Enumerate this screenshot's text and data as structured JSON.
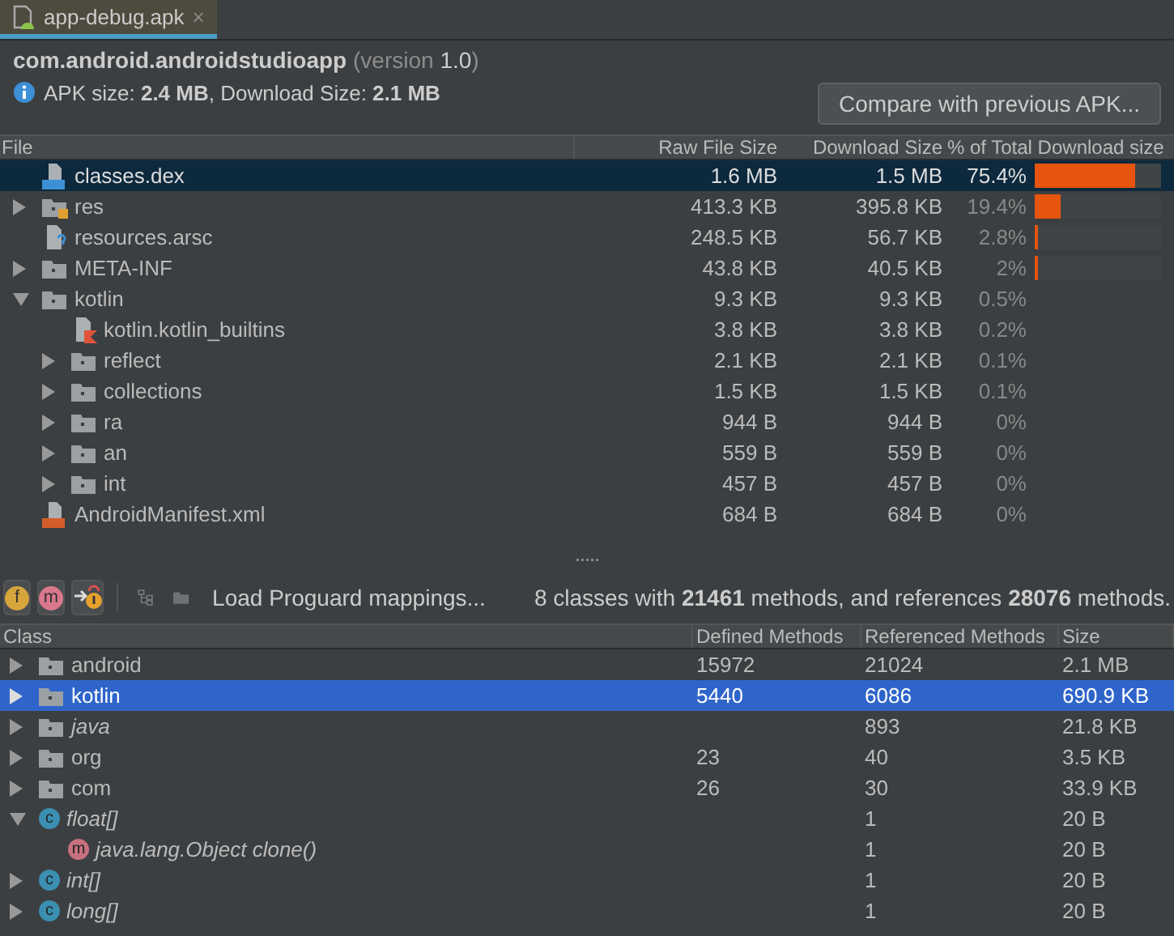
{
  "tab": {
    "label": "app-debug.apk",
    "close": "×",
    "selected": true
  },
  "header": {
    "package": "com.android.androidstudioapp",
    "version_label": "(version",
    "version": "1.0",
    "version_close": ")",
    "size_line": "APK size: **2.4 MB**, Download Size: **2.1 MB**",
    "compare_button": "Compare with previous APK..."
  },
  "file_table": {
    "columns": [
      "File",
      "Raw File Size",
      "Download Size",
      "% of Total Download size"
    ],
    "rows": [
      {
        "name": "classes.dex",
        "kind": "dex",
        "selected": true,
        "raw": "1.6 MB",
        "download": "1.5 MB",
        "percent": "75.4%",
        "level": 0.8
      },
      {
        "name": "res",
        "kind": "res",
        "selected": false,
        "expanded": false,
        "raw": "413.3 KB",
        "download": "395.8 KB",
        "percent": "19.4%",
        "level": 0.21
      },
      {
        "name": "resources.arsc",
        "kind": "arsc",
        "selected": false,
        "raw": "248.5 KB",
        "download": "56.7 KB",
        "percent": "2.8%",
        "level": 0.03
      },
      {
        "name": "META-INF",
        "kind": "folder",
        "selected": false,
        "expanded": false,
        "raw": "43.8 KB",
        "download": "40.5 KB",
        "percent": "2%",
        "level": 0.02
      },
      {
        "name": "kotlin",
        "kind": "folder",
        "selected": false,
        "expanded": true,
        "raw": "9.3 KB",
        "download": "9.3 KB",
        "percent": "0.5%",
        "children": [
          {
            "name": "kotlin.kotlin_builtins",
            "kind": "kotlin",
            "selected": false,
            "raw": "3.8 KB",
            "download": "3.8 KB",
            "percent": "0.2%"
          },
          {
            "name": "reflect",
            "kind": "folder",
            "selected": false,
            "expanded": false,
            "raw": "2.1 KB",
            "download": "2.1 KB",
            "percent": "0.1%"
          },
          {
            "name": "collections",
            "kind": "folder",
            "selected": false,
            "expanded": false,
            "raw": "1.5 KB",
            "download": "1.5 KB",
            "percent": "0.1%"
          },
          {
            "name": "ra",
            "kind": "folder",
            "selected": false,
            "expanded": false,
            "raw": "944 B",
            "download": "944 B",
            "percent": "0%"
          },
          {
            "name": "an",
            "kind": "folder",
            "selected": false,
            "expanded": false,
            "raw": "559 B",
            "download": "559 B",
            "percent": "0%"
          },
          {
            "name": "int",
            "kind": "folder",
            "selected": false,
            "expanded": false,
            "raw": "457 B",
            "download": "457 B",
            "percent": "0%"
          }
        ]
      },
      {
        "name": "AndroidManifest.xml",
        "kind": "xml",
        "selected": false,
        "raw": "684 B",
        "download": "684 B",
        "percent": "0%"
      }
    ]
  },
  "toolbar": {
    "buttons": [
      {
        "kind": "field",
        "letter": "f"
      },
      {
        "kind": "method",
        "letter": "m"
      },
      {
        "kind": "referenced"
      }
    ],
    "load_link": "Load Proguard mappings...",
    "summary": "8 classes with **21461** methods, and references **28076** methods."
  },
  "class_table": {
    "columns": [
      "Class",
      "Defined Methods",
      "Referenced Methods",
      "Size"
    ],
    "rows": [
      {
        "name": "android",
        "kind": "package",
        "italic": false,
        "selected": false,
        "expanded": false,
        "defined": "15972",
        "referenced": "21024",
        "size": "2.1 MB"
      },
      {
        "name": "kotlin",
        "kind": "package",
        "italic": false,
        "selected": true,
        "expanded": false,
        "defined": "5440",
        "referenced": "6086",
        "size": "690.9 KB"
      },
      {
        "name": "java",
        "kind": "package",
        "italic": true,
        "selected": false,
        "expanded": false,
        "referenced": "893",
        "size": "21.8 KB"
      },
      {
        "name": "org",
        "kind": "package",
        "italic": false,
        "selected": false,
        "expanded": false,
        "defined": "23",
        "referenced": "40",
        "size": "3.5 KB"
      },
      {
        "name": "com",
        "kind": "package",
        "italic": false,
        "selected": false,
        "expanded": false,
        "defined": "26",
        "referenced": "30",
        "size": "33.9 KB"
      },
      {
        "name": "float[]",
        "kind": "class",
        "letter": "c",
        "italic": true,
        "selected": false,
        "expanded": true,
        "referenced": "1",
        "size": "20 B",
        "children": [
          {
            "name": "java.lang.Object clone()",
            "kind": "method",
            "letter": "m",
            "italic": true,
            "selected": false,
            "referenced": "1",
            "size": "20 B"
          }
        ]
      },
      {
        "name": "int[]",
        "kind": "class",
        "letter": "c",
        "italic": true,
        "selected": false,
        "expanded": false,
        "referenced": "1",
        "size": "20 B"
      },
      {
        "name": "long[]",
        "kind": "class",
        "letter": "c",
        "italic": true,
        "selected": false,
        "expanded": false,
        "referenced": "1",
        "size": "20 B"
      }
    ]
  }
}
